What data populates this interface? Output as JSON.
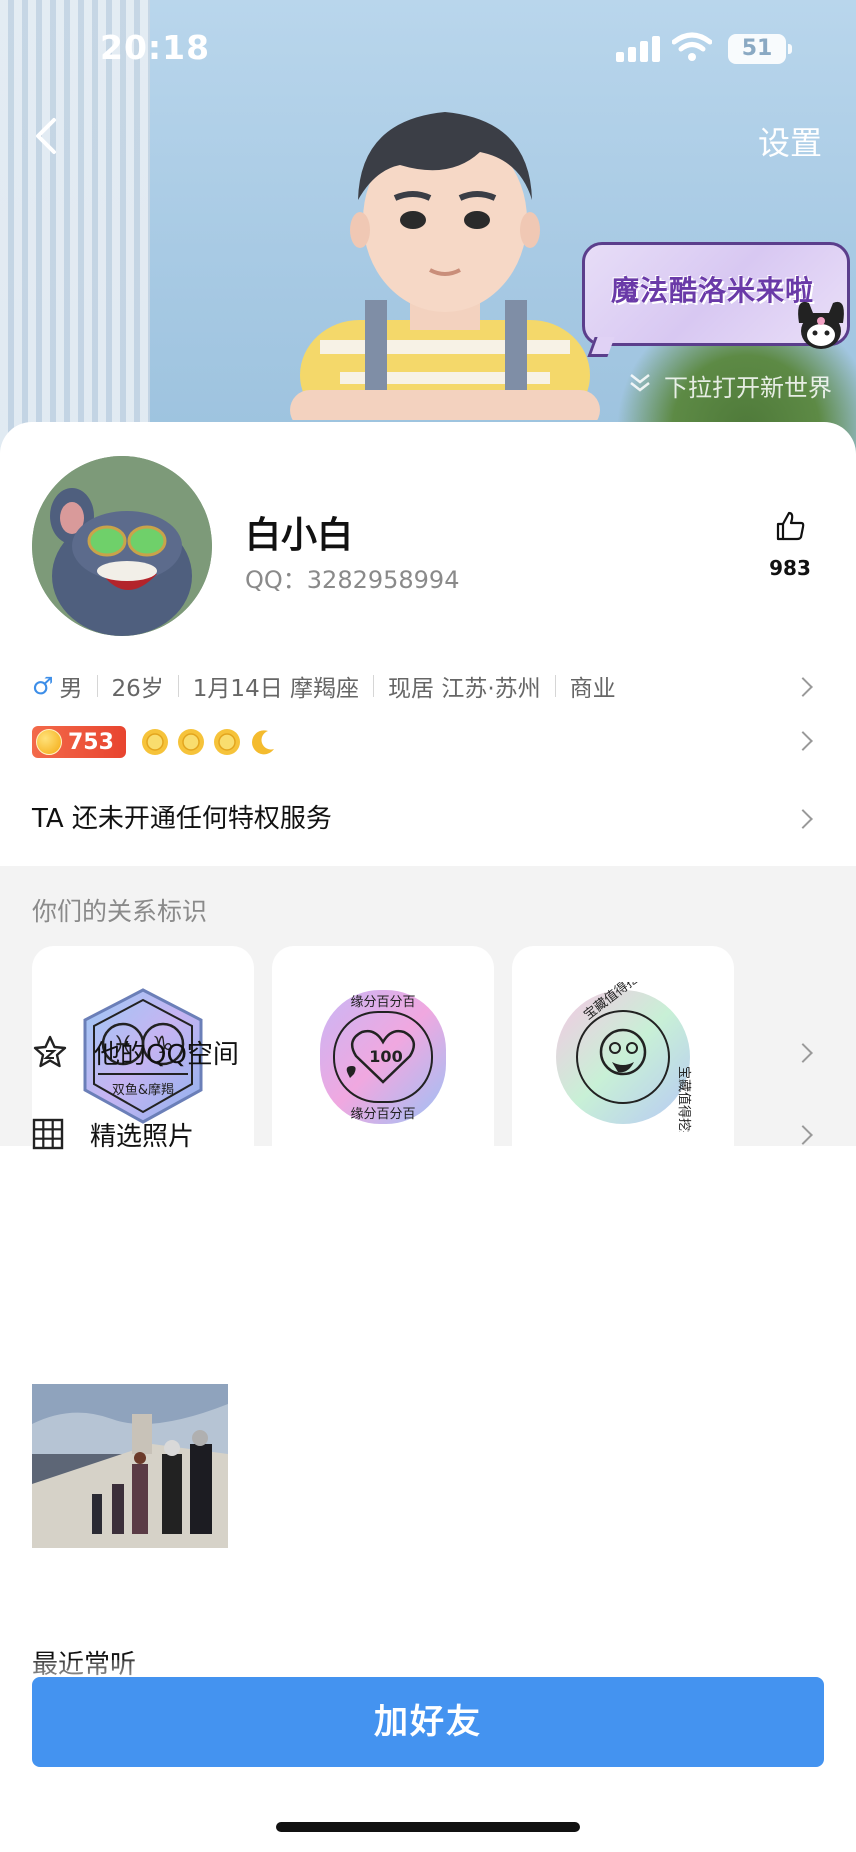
{
  "status_bar": {
    "time": "20:18",
    "battery": "51"
  },
  "header": {
    "settings_label": "设置",
    "bubble_text": "魔法酷洛米来啦",
    "pull_hint": "下拉打开新世界"
  },
  "profile": {
    "nickname": "白小白",
    "qq_label": "QQ：3282958994",
    "like_count": "983",
    "gender": "男",
    "age": "26岁",
    "birthday": "1月14日 摩羯座",
    "location": "现居 江苏·苏州",
    "industry": "商业",
    "level": "753",
    "privilege_text": "TA 还未开通任何特权服务"
  },
  "relation": {
    "title": "你们的关系标识",
    "badges": [
      {
        "text": "双鱼&摩羯"
      },
      {
        "text_top": "缘分百分百",
        "text_bottom": "缘分百分百"
      },
      {
        "text_top": "宝藏值得挖掘"
      }
    ]
  },
  "menu": {
    "qzone_label": "他的QQ空间",
    "photos_label": "精选照片",
    "recent_label": "最近常听"
  },
  "actions": {
    "add_friend_label": "加好友"
  },
  "colors": {
    "accent": "#4493f0",
    "level_badge": "#e8442f",
    "male": "#3d8ee8"
  }
}
